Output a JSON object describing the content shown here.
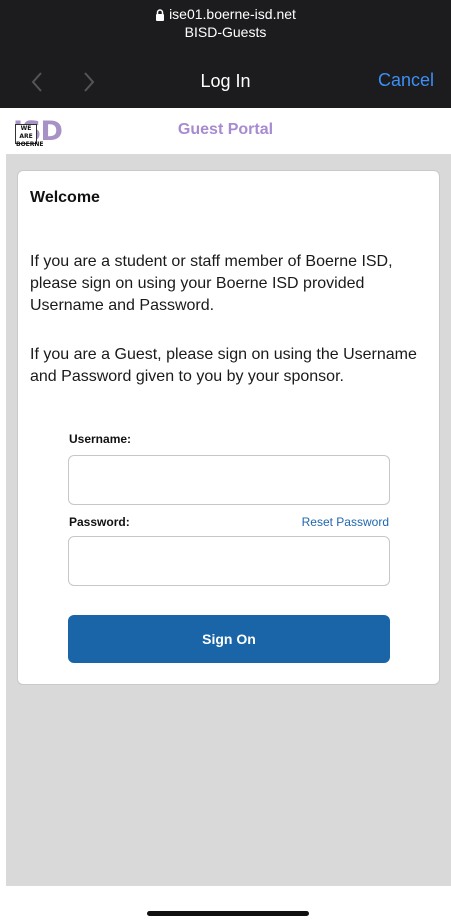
{
  "browser": {
    "url": "ise01.boerne-isd.net",
    "network": "BISD-Guests",
    "nav_title": "Log In",
    "cancel_label": "Cancel"
  },
  "portal": {
    "logo_tag": "WE ARE BOERNE",
    "logo_text": "ISD",
    "title": "Guest Portal"
  },
  "form": {
    "heading": "Welcome",
    "para1": "If you are a student or staff member of Boerne ISD, please sign on using your Boerne ISD provided Username and Password.",
    "para2": "If you are a Guest, please sign on using the Username and Password given to you by your sponsor.",
    "username_label": "Username:",
    "username_value": "",
    "password_label": "Password:",
    "password_value": "",
    "reset_label": "Reset Password",
    "signon_label": "Sign On"
  },
  "colors": {
    "accent": "#1a65a7",
    "portal_title": "#a78bd0",
    "cancel": "#3b8ff5"
  }
}
